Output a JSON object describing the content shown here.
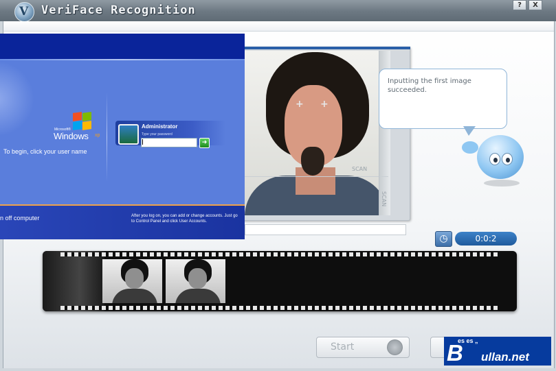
{
  "window": {
    "title": "VeriFace Recognition",
    "logo_letter": "V",
    "help_label": "?",
    "close_label": "X"
  },
  "tooltip": {
    "message": "Inputting the first image succeeded."
  },
  "camera": {
    "overlay_label_1": "SCAN",
    "overlay_label_2": "SCAN",
    "landmark_marker": "+"
  },
  "timer": {
    "value": "0:0:2"
  },
  "controls": {
    "start_label": "Start"
  },
  "captured_frames": {
    "count": 2
  },
  "xp_login": {
    "brand_small": "Microsoft®",
    "brand": "Windows",
    "brand_suffix": "xp",
    "begin_text": "To begin, click your user name",
    "user_name": "Administrator",
    "password_hint": "Type your password",
    "turn_off": "n off computer",
    "after_logon": "After you log on, you can add or change accounts. Just go to Control Panel and click User Accounts."
  },
  "watermark": {
    "text": "ullan.net",
    "big_letter": "B",
    "top_marks": "es es „"
  },
  "colors": {
    "accent": "#2a5fa8",
    "timer": "#1f5a9c",
    "xp_blue": "#5a7edc",
    "watermark_bg": "#063b9e"
  }
}
